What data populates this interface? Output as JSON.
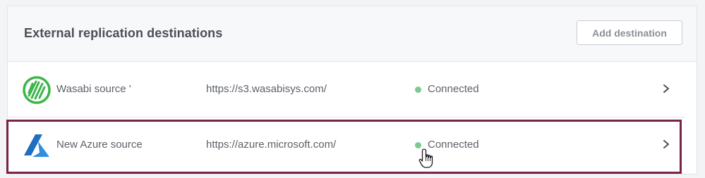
{
  "panel": {
    "title": "External replication destinations",
    "add_button_label": "Add destination"
  },
  "destinations": [
    {
      "name": "Wasabi source '",
      "url": "https://s3.wasabisys.com/",
      "status": "Connected",
      "logo_icon": "wasabi-logo",
      "brand_color": "#3db54a"
    },
    {
      "name": "New Azure source",
      "url": "https://azure.microsoft.com/",
      "status": "Connected",
      "logo_icon": "azure-logo",
      "brand_color": "#1f78c8"
    }
  ],
  "colors": {
    "status_connected": "#7cc991",
    "highlight": "#7a2148"
  }
}
